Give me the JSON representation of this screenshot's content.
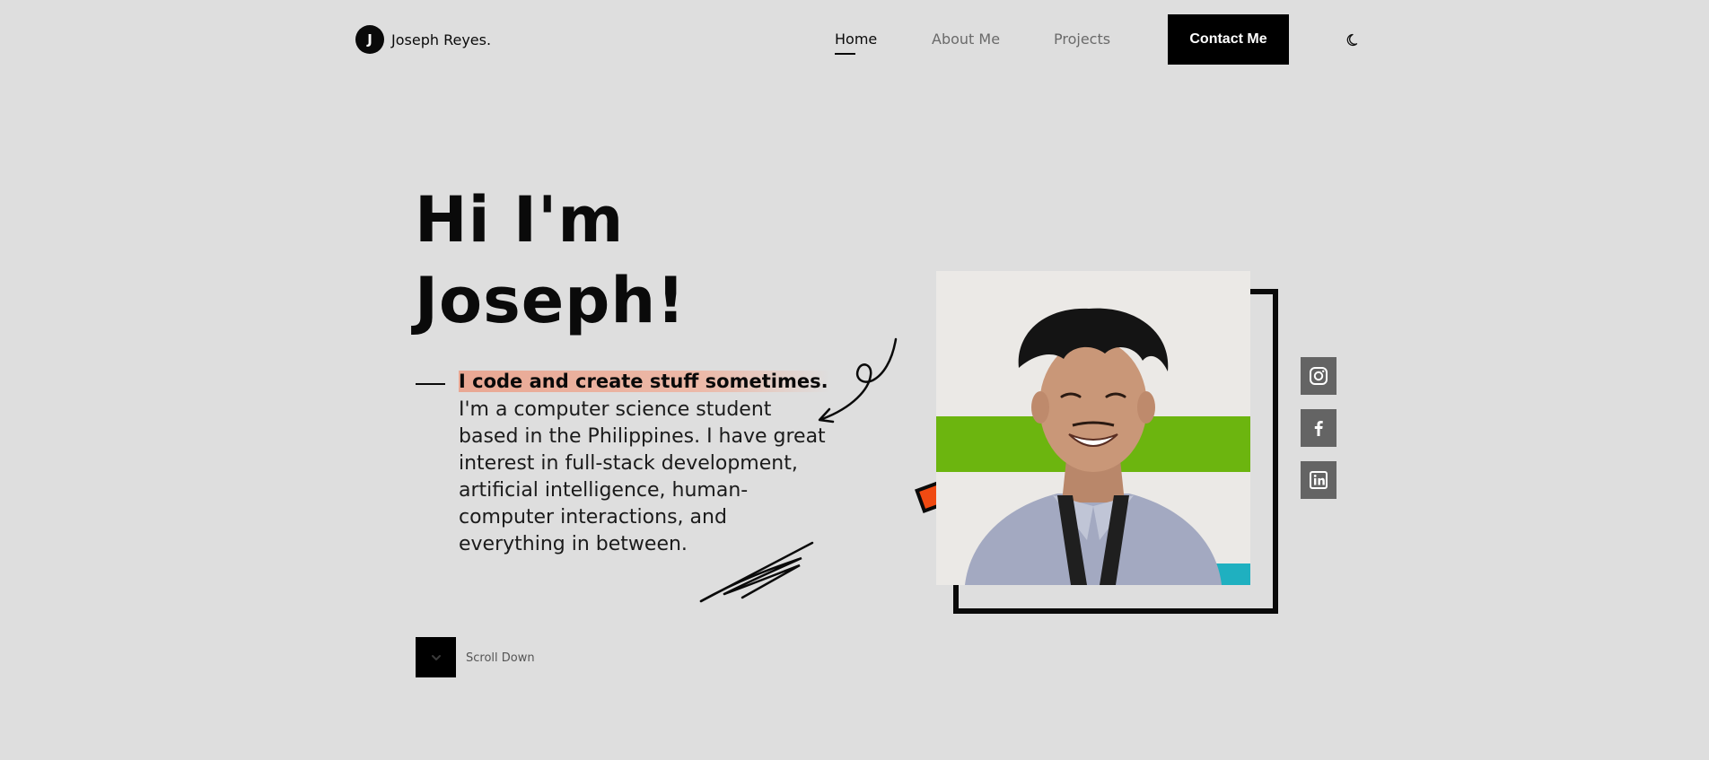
{
  "header": {
    "logo_letter": "J",
    "logo_name": "Joseph Reyes.",
    "nav": {
      "home": "Home",
      "about": "About Me",
      "projects": "Projects"
    },
    "contact_label": "Contact Me",
    "theme_icon": "moon-icon"
  },
  "hero": {
    "title_line1": "Hi I'm",
    "title_line2": "Joseph!",
    "tagline": "I code and create stuff sometimes.",
    "bio": "I'm a computer science student based in the Philippines. I have great interest in full-stack development, artificial intelligence, human-computer interactions, and everything in between."
  },
  "social": [
    {
      "icon": "instagram-icon"
    },
    {
      "icon": "facebook-icon"
    },
    {
      "icon": "linkedin-icon"
    }
  ],
  "scroll": {
    "label": "Scroll Down",
    "icon": "chevron-down-icon"
  },
  "colors": {
    "background": "#dedede",
    "accent_highlight": "#e9a793",
    "orange": "#f04a12",
    "social_bg": "#646464"
  }
}
